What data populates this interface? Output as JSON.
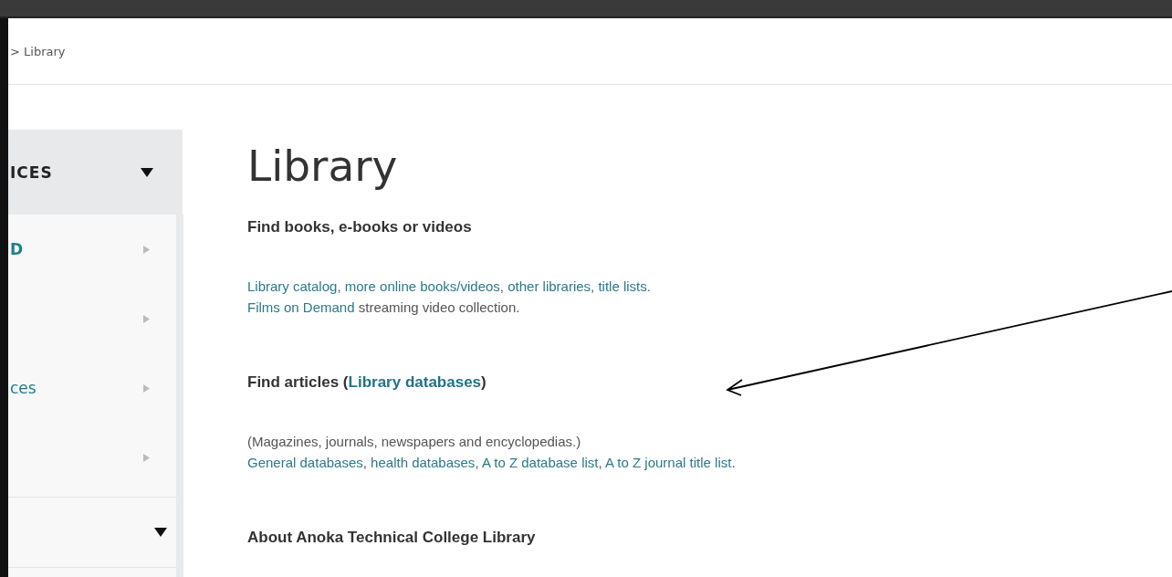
{
  "breadcrumb": "> Library",
  "sidebar": {
    "header": {
      "label": "ICES",
      "expanded": true
    },
    "items": [
      {
        "label": "D",
        "bold": true,
        "expanded": false
      },
      {
        "expanded": false
      },
      {
        "label": "ces",
        "bold": false,
        "expanded": false
      },
      {
        "expanded": false
      }
    ],
    "sections": [
      {
        "expanded": true
      }
    ]
  },
  "page_title": "Library",
  "sections": [
    {
      "heading": [
        {
          "text": "Find books, e-books or videos",
          "link": false
        }
      ],
      "lines": [
        [
          {
            "text": "Library catalog",
            "link": true
          },
          {
            "text": ",  ",
            "link": false
          },
          {
            "text": "more online books/videos",
            "link": true
          },
          {
            "text": ", ",
            "link": false
          },
          {
            "text": "other libraries",
            "link": true
          },
          {
            "text": ", ",
            "link": false
          },
          {
            "text": "title lists",
            "link": true
          },
          {
            "text": ".",
            "link": false
          }
        ],
        [
          {
            "text": "Films on Demand",
            "link": true
          },
          {
            "text": " streaming video collection.",
            "link": false
          }
        ]
      ]
    },
    {
      "heading": [
        {
          "text": "Find articles (",
          "link": false
        },
        {
          "text": "Library databases",
          "link": true
        },
        {
          "text": ")",
          "link": false
        }
      ],
      "lines": [
        [
          {
            "text": "(Magazines, journals, newspapers and encyclopedias.)",
            "link": false
          }
        ],
        [
          {
            "text": "General databases",
            "link": true
          },
          {
            "text": ", ",
            "link": false
          },
          {
            "text": "health databases",
            "link": true
          },
          {
            "text": ", ",
            "link": false
          },
          {
            "text": "A to Z database list",
            "link": true
          },
          {
            "text": ", ",
            "link": false
          },
          {
            "text": "A to Z journal title list",
            "link": true
          },
          {
            "text": ".",
            "link": false
          }
        ]
      ]
    },
    {
      "heading": [
        {
          "text": "About Anoka Technical College Library",
          "link": false
        }
      ]
    }
  ],
  "annotation": {
    "kind": "arrow"
  }
}
